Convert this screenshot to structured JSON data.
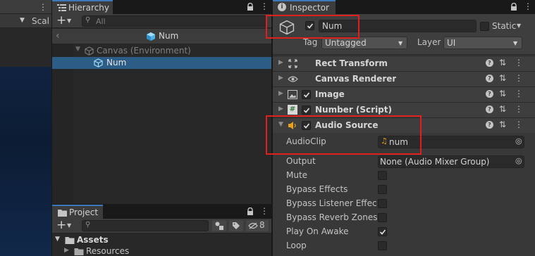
{
  "scene": {
    "scale_label": "Scal"
  },
  "hierarchy": {
    "tab_label": "Hierarchy",
    "search_placeholder": "All",
    "header_title": "Num",
    "items": [
      {
        "label": "Canvas (Environment)"
      },
      {
        "label": "Num"
      }
    ]
  },
  "inspector": {
    "tab_label": "Inspector",
    "object_name": "Num",
    "static_label": "Static",
    "tag_label": "Tag",
    "tag_value": "Untagged",
    "layer_label": "Layer",
    "layer_value": "UI",
    "components": [
      {
        "name": "Rect Transform"
      },
      {
        "name": "Canvas Renderer"
      },
      {
        "name": "Image"
      },
      {
        "name": "Number (Script)"
      },
      {
        "name": "Audio Source"
      }
    ],
    "audio": {
      "clip_label": "AudioClip",
      "clip_value": "num",
      "output_label": "Output",
      "output_value": "None (Audio Mixer Group)",
      "props": [
        {
          "label": "Mute",
          "checked": false
        },
        {
          "label": "Bypass Effects",
          "checked": false
        },
        {
          "label": "Bypass Listener Effects",
          "checked": false
        },
        {
          "label": "Bypass Reverb Zones",
          "checked": false
        },
        {
          "label": "Play On Awake",
          "checked": true
        },
        {
          "label": "Loop",
          "checked": false
        }
      ]
    }
  },
  "project": {
    "tab_label": "Project",
    "hidden_count": "8",
    "tree": [
      {
        "label": "Assets"
      },
      {
        "label": "Resources"
      }
    ]
  },
  "colors": {
    "selection": "#2c5d87",
    "highlight_box": "#e0201c",
    "tab_accent": "#3a79bb"
  }
}
